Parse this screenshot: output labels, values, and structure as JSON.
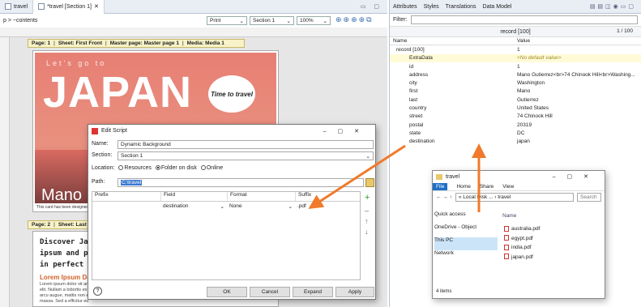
{
  "editor": {
    "tabs": [
      {
        "label": "travel"
      },
      {
        "label": "*travel [Section 1]"
      }
    ],
    "breadcrumb": "p > ~contents",
    "toolbar": {
      "print": "Print",
      "section": "Section 1",
      "zoom": "100%"
    },
    "page1_bar": {
      "page": "Page: 1",
      "sheet": "Sheet: First Front",
      "master": "Master page: Master page 1",
      "media": "Media: Media 1"
    },
    "page2_bar": {
      "page": "Page: 2",
      "sheet": "Sheet: Last"
    },
    "hero": {
      "small": "Let's go to",
      "title": "JAPAN",
      "stamp": "Time to travel",
      "name": "Mano"
    },
    "caption": "This card has been designed",
    "body": {
      "heading": "Discover Japa ipsum and pro in perfect har",
      "lead": "Lorem Ipsum Dolo",
      "p1": "Lorem ipsum dolor sit am",
      "p2": "elit. Nullam a lobortis ex",
      "p3": "arcu augue, mattis non e",
      "p4": "massa. Sed a efficitur eu"
    }
  },
  "right": {
    "tabs": [
      {
        "label": "Attributes"
      },
      {
        "label": "Styles"
      },
      {
        "label": "Translations"
      },
      {
        "label": "Data Model"
      }
    ],
    "filter_label": "Filter:",
    "record_label": "record [100]",
    "pager": "1",
    "pager_total": "100",
    "columns": {
      "name": "Name",
      "value": "Value"
    },
    "rows": [
      {
        "name": "record [100]",
        "value": "1"
      },
      {
        "name": "ExtraData",
        "value": "<No default value>"
      },
      {
        "name": "id",
        "value": "1"
      },
      {
        "name": "address",
        "value": "Mano Gutierrez<br>74 Chinook Hill<br>Washing..."
      },
      {
        "name": "city",
        "value": "Washington"
      },
      {
        "name": "first",
        "value": "Mano"
      },
      {
        "name": "last",
        "value": "Gutierrez"
      },
      {
        "name": "country",
        "value": "United States"
      },
      {
        "name": "street",
        "value": "74 Chinook Hill"
      },
      {
        "name": "postal",
        "value": "20319"
      },
      {
        "name": "state",
        "value": "DC"
      },
      {
        "name": "destination",
        "value": "japan"
      }
    ]
  },
  "dialog": {
    "title": "Edit Script",
    "name_label": "Name:",
    "name_value": "Dynamic Background",
    "section_label": "Section:",
    "section_value": "Section 1",
    "location_label": "Location:",
    "opt_resources": "Resources",
    "opt_folder": "Folder on disk",
    "opt_online": "Online",
    "path_label": "Path:",
    "path_value": "C:\\travel",
    "columns": {
      "prefix": "Prefix",
      "field": "Field",
      "format": "Format",
      "suffix": "Suffix"
    },
    "row": {
      "field": "destination",
      "format": "None",
      "suffix": ".pdf"
    },
    "buttons": {
      "ok": "OK",
      "cancel": "Cancel",
      "expand": "Expand",
      "apply": "Apply"
    }
  },
  "explorer": {
    "title": "travel",
    "ribbon": [
      "File",
      "Home",
      "Share",
      "View"
    ],
    "address": "« Local Disk ... › travel",
    "search": "Search",
    "nav": [
      "Quick access",
      "OneDrive - Object",
      "This PC",
      "Network"
    ],
    "col_name": "Name",
    "files": [
      "australia.pdf",
      "egypt.pdf",
      "india.pdf",
      "japan.pdf"
    ],
    "status": "4 items"
  },
  "colors": {
    "accent": "#f07a2a",
    "hero": "#e77f74"
  }
}
